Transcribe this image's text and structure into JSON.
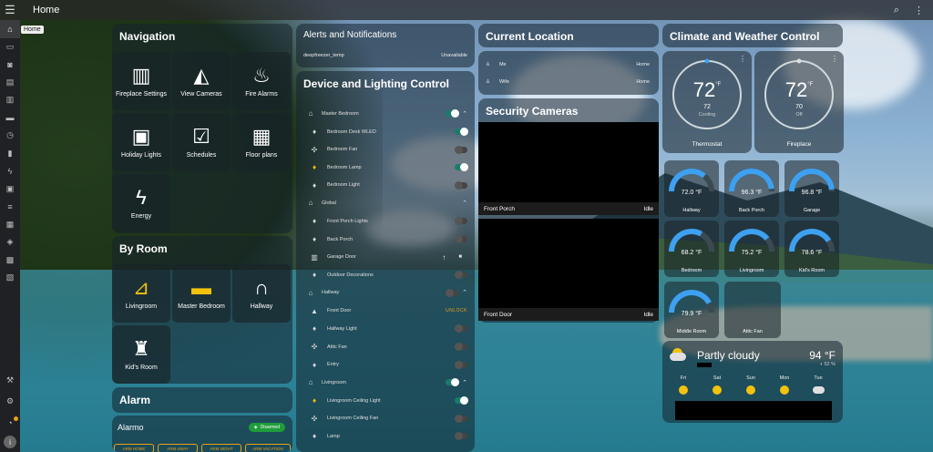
{
  "topbar": {
    "title": "Home"
  },
  "tooltip": "Home",
  "navigation": {
    "title": "Navigation",
    "tiles": [
      {
        "label": "Fireplace Settings",
        "icon": "fireplace-icon"
      },
      {
        "label": "View Cameras",
        "icon": "cctv-icon"
      },
      {
        "label": "Fire Alarms",
        "icon": "fire-alert-icon"
      },
      {
        "label": "Holiday Lights",
        "icon": "calendar-alert-icon"
      },
      {
        "label": "Schedules",
        "icon": "calendar-check-icon"
      },
      {
        "label": "Floor plans",
        "icon": "floor-plan-icon"
      },
      {
        "label": "Energy",
        "icon": "lightning-icon"
      }
    ]
  },
  "by_room": {
    "title": "By Room",
    "tiles": [
      {
        "label": "Livingroom",
        "icon": "seat-icon"
      },
      {
        "label": "Master Bedroom",
        "icon": "bed-icon"
      },
      {
        "label": "Hallway",
        "icon": "door-arch-icon"
      },
      {
        "label": "Kid's Room",
        "icon": "castle-icon"
      }
    ]
  },
  "alarm": {
    "title": "Alarm",
    "name": "Alarmo",
    "status": "Disarmed",
    "buttons": [
      "ARM HOME",
      "ARM AWAY",
      "ARM NIGHT",
      "ARM VACATION"
    ]
  },
  "alerts": {
    "title": "Alerts and Notifications",
    "items": [
      {
        "name": "deepfreezer_temp",
        "state": "Unavailable"
      }
    ]
  },
  "devices": {
    "title": "Device and Lighting Control",
    "rows": [
      {
        "label": "Master Bedroom",
        "type": "group",
        "on": true
      },
      {
        "label": "Bedroom Desk WLED",
        "on": true
      },
      {
        "label": "Bedroom Fan",
        "on": false
      },
      {
        "label": "Bedroom Lamp",
        "on": true,
        "yellow": true
      },
      {
        "label": "Bedroom Light",
        "on": false
      },
      {
        "label": "Global",
        "type": "group"
      },
      {
        "label": "Front Porch Lights",
        "on": false
      },
      {
        "label": "Back Porch",
        "on": false
      },
      {
        "label": "Garage Door",
        "type": "cover"
      },
      {
        "label": "Outdoor Decorations",
        "on": false
      },
      {
        "label": "Hallway",
        "type": "group",
        "on": false
      },
      {
        "label": "Front Door",
        "type": "lock",
        "action": "UNLOCK"
      },
      {
        "label": "Hallway Light",
        "on": false
      },
      {
        "label": "Attic Fan",
        "on": false
      },
      {
        "label": "Entry",
        "on": false
      },
      {
        "label": "Livingroom",
        "type": "group",
        "on": true
      },
      {
        "label": "Livingroom Ceiling Light",
        "on": true,
        "yellow": true
      },
      {
        "label": "Livingroom Ceiling Fan",
        "on": false
      },
      {
        "label": "Lamp",
        "on": false
      }
    ]
  },
  "location": {
    "title": "Current Location",
    "people": [
      {
        "name": "Me",
        "state": "Home"
      },
      {
        "name": "Wife",
        "state": "Home"
      }
    ]
  },
  "cameras": {
    "title": "Security Cameras",
    "items": [
      {
        "name": "Front Porch",
        "state": "Idle"
      },
      {
        "name": "Front Door",
        "state": "Idle"
      }
    ]
  },
  "climate": {
    "title": "Climate and Weather Control",
    "thermostats": [
      {
        "name": "Thermostat",
        "target": "72",
        "unit": "°F",
        "current": "72",
        "mode": "Cooling",
        "color": "#3da0f0"
      },
      {
        "name": "Fireplace",
        "target": "72",
        "unit": "°F",
        "current": "70",
        "mode": "Off",
        "color": "#dddddd"
      }
    ],
    "gauges": [
      {
        "name": "Hallway",
        "value": "72.0 °F",
        "level": 0.72
      },
      {
        "name": "Back Porch",
        "value": "96.3 °F",
        "level": 0.96
      },
      {
        "name": "Garage",
        "value": "96.8 °F",
        "level": 0.97
      },
      {
        "name": "Bedroom",
        "value": "68.2 °F",
        "level": 0.66
      },
      {
        "name": "Livingroom",
        "value": "75.2 °F",
        "level": 0.78
      },
      {
        "name": "Kid's Room",
        "value": "78.6 °F",
        "level": 0.82
      },
      {
        "name": "Middle Room",
        "value": "79.9 °F",
        "level": 0.84
      }
    ],
    "fan": {
      "name": "Attic Fan"
    }
  },
  "weather": {
    "condition": "Partly cloudy",
    "temp": "94 °F",
    "humidity": "52 %",
    "forecast": [
      {
        "day": "Fri",
        "icon": "sun"
      },
      {
        "day": "Sat",
        "icon": "sun"
      },
      {
        "day": "Sun",
        "icon": "sun"
      },
      {
        "day": "Mon",
        "icon": "sun"
      },
      {
        "day": "Tue",
        "icon": "cloud"
      }
    ]
  },
  "colors": {
    "accent": "#3da0f0",
    "on_toggle": "#1b7b6b",
    "yellow": "#f2c20c",
    "orange": "#e8a317",
    "disarmed": "#1f9d3a"
  }
}
